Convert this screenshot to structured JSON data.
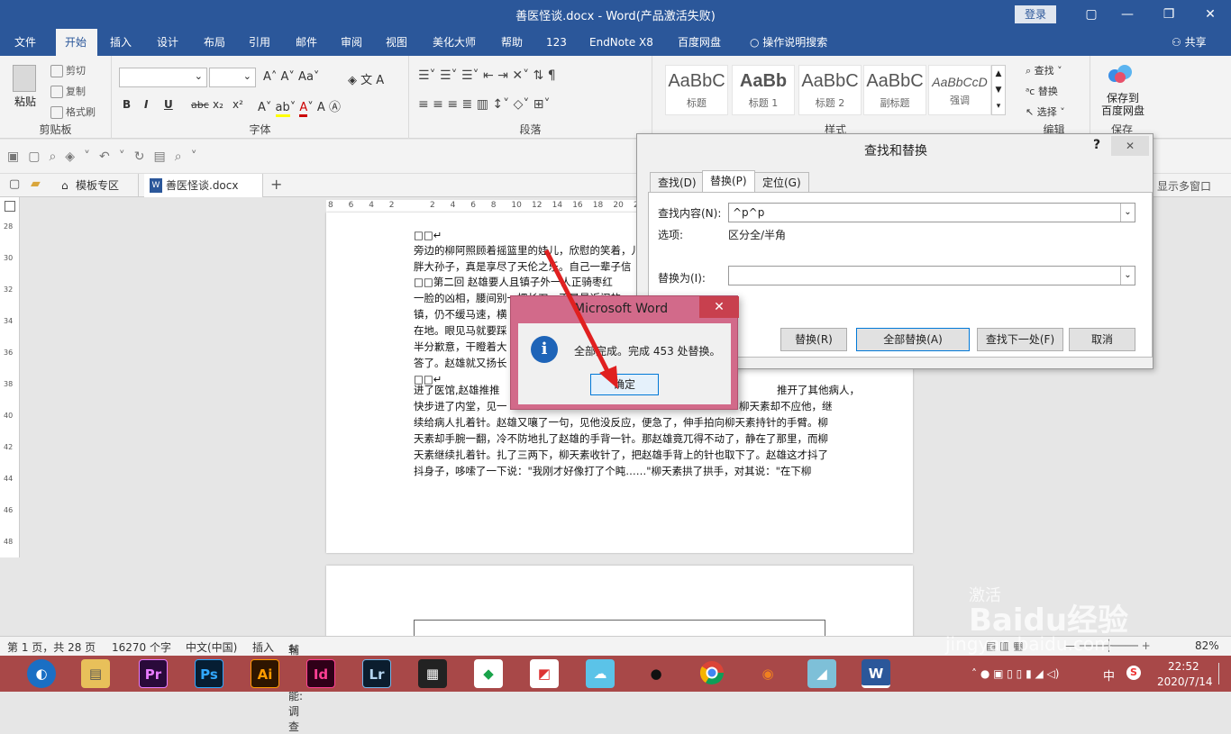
{
  "titlebar": {
    "title": "善医怪谈.docx  -  Word(产品激活失败)",
    "login": "登录",
    "minimize": "—",
    "restore": "❐",
    "close": "✕"
  },
  "menu": {
    "tabs": [
      "文件",
      "开始",
      "插入",
      "设计",
      "布局",
      "引用",
      "邮件",
      "审阅",
      "视图",
      "美化大师",
      "帮助",
      "123",
      "EndNote X8",
      "百度网盘",
      "操作说明搜索"
    ],
    "active": "开始",
    "share": "共享"
  },
  "ribbon": {
    "clipboard": {
      "label": "剪贴板",
      "paste": "粘贴",
      "cut": "剪切",
      "copy": "复制",
      "format_painter": "格式刷"
    },
    "font": {
      "label": "字体",
      "bold": "B",
      "italic": "I",
      "underline": "U",
      "strike": "abc",
      "sub": "x₂",
      "sup": "x²"
    },
    "paragraph": {
      "label": "段落"
    },
    "styles": {
      "label": "样式",
      "items": [
        {
          "preview": "AaBbC",
          "name": "标题"
        },
        {
          "preview": "AaBb",
          "name": "标题 1"
        },
        {
          "preview": "AaBbC",
          "name": "标题 2"
        },
        {
          "preview": "AaBbC",
          "name": "副标题"
        },
        {
          "preview": "AaBbCcD",
          "name": "强调"
        }
      ]
    },
    "editing": {
      "label": "编辑",
      "find": "查找",
      "replace": "替换",
      "select": "选择"
    },
    "save": {
      "line1": "保存到",
      "line2": "百度网盘",
      "label": "保存"
    }
  },
  "doctabs": {
    "items": [
      "模板专区",
      "善医怪谈.docx"
    ],
    "add": "+",
    "right": "显示多窗口"
  },
  "ruler": {
    "ticks": [
      "8",
      "6",
      "4",
      "2",
      "",
      "2",
      "4",
      "6",
      "8",
      "10",
      "12",
      "14",
      "16",
      "18",
      "20",
      "22",
      "24"
    ]
  },
  "vruler": {
    "ticks": [
      "28",
      "30",
      "32",
      "34",
      "36",
      "38",
      "40",
      "42",
      "44",
      "46",
      "48"
    ]
  },
  "document": {
    "lines": [
      "□□↵",
      "旁边的柳阿照顾着摇篮里的娃儿，欣慰的笑着，儿",
      "胖大孙子，真是享尽了天伦之乐。自己一辈子信",
      "□□第二回  赵雄要人且镇子外一人正骑枣红",
      "一脸的凶相，腰间别一把长刀，正是最近闹的",
      "镇，仍不缓马速，横",
      "在地。眼见马就要踩",
      "半分歉意，干瞪着大",
      "答了。赵雄就又扬长",
      "□□↵",
      "进了医馆,赵雄推推",
      "快步进了内堂，见一",
      "续给病人扎着针。赵雄又嚷了一句，见他没反应，便急了，伸手拍向柳天素持针的手臂。柳",
      "天素却手腕一翻，冷不防地扎了赵雄的手背一针。那赵雄竟兀得不动了，静在了那里，而柳",
      "天素继续扎着针。扎了三两下，柳天素收针了，把赵雄手背上的针也取下了。赵雄这才抖了",
      "抖身子，哆嗦了一下说：\"我刚才好像打了个盹……\"柳天素拱了拱手，对其说：\"在下柳"
    ],
    "right_fragments": [
      "推开了其他病人，",
      "柳天素却不应他，继"
    ]
  },
  "find_replace": {
    "title": "查找和替换",
    "help": "?",
    "close": "✕",
    "tabs": [
      "查找(D)",
      "替换(P)",
      "定位(G)"
    ],
    "active_tab": "替换(P)",
    "find_label": "查找内容(N):",
    "find_value": "^p^p",
    "options_label": "选项:",
    "options_value": "区分全/半角",
    "replace_label": "替换为(I):",
    "replace_value": "",
    "buttons": [
      "替换(R)",
      "全部替换(A)",
      "查找下一处(F)",
      "取消"
    ]
  },
  "msgbox": {
    "title": "Microsoft Word",
    "close": "✕",
    "message": "全部完成。完成 453 处替换。",
    "ok": "确定",
    "icon": "i"
  },
  "status": {
    "page": "第 1 页，共 28 页",
    "words": "16270 个字",
    "lang": "中文(中国)",
    "mode": "插入",
    "access": "辅助功能: 调查",
    "zoom": "82%"
  },
  "taskbar": {
    "apps": [
      "Pr",
      "Ps",
      "Ai",
      "Id",
      "Lr"
    ],
    "time": "22:52",
    "date": "2020/7/14",
    "ime": "中"
  },
  "watermark": {
    "line1": "激活",
    "brand": "Baidu经验",
    "url": "jingyan.baidu.com"
  }
}
